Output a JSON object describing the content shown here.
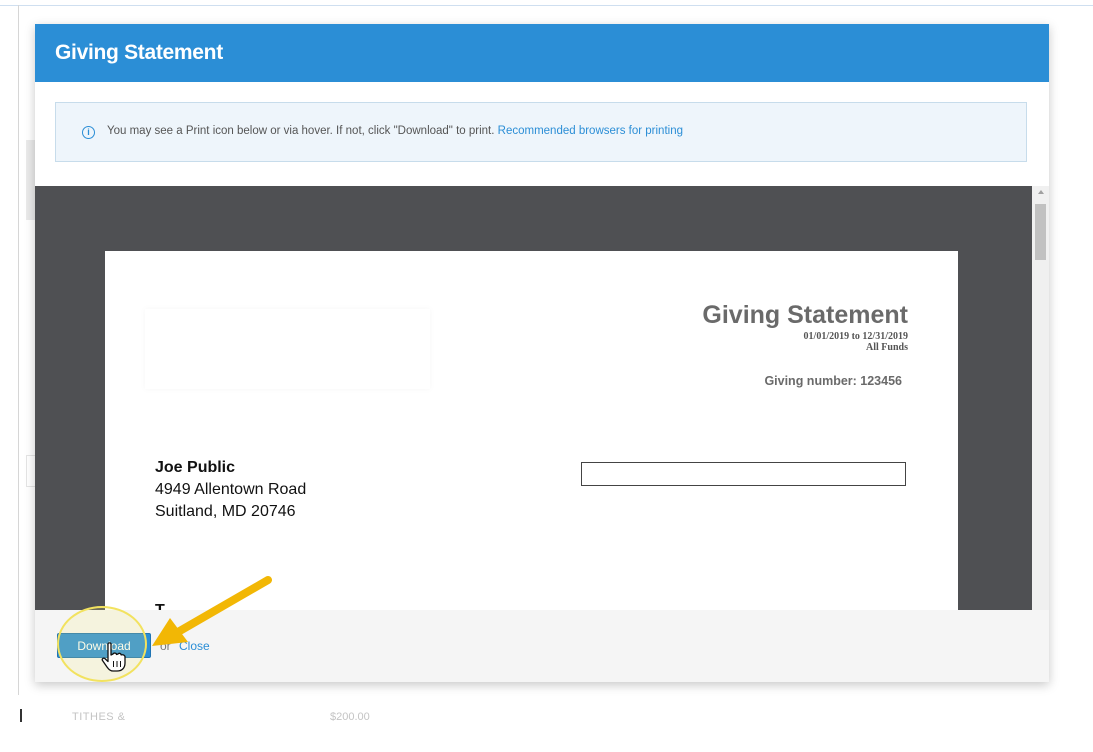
{
  "background": {
    "row_label": "TITHES &",
    "row_amount": "$200.00"
  },
  "modal": {
    "title": "Giving Statement",
    "info": {
      "icon": "info-icon",
      "text": "You may see a Print icon below or via hover. If not, click \"Download\" to print.",
      "link_text": "Recommended browsers for printing"
    },
    "document": {
      "title": "Giving Statement",
      "date_range": "01/01/2019 to 12/31/2019",
      "funds": "All Funds",
      "giving_number": "Giving number: 123456",
      "donor": {
        "name": "Joe Public",
        "street": "4949 Allentown Road",
        "city": "Suitland, MD 20746"
      },
      "next_heading": "T"
    },
    "footer": {
      "download_label": "Download",
      "or_text": "or",
      "close_label": "Close"
    }
  },
  "annotations": {
    "arrow_color": "#f2b705",
    "highlight_color": "#f2e25f"
  },
  "colors": {
    "accent": "#2b8ed6",
    "viewer_background": "#4f5053"
  }
}
